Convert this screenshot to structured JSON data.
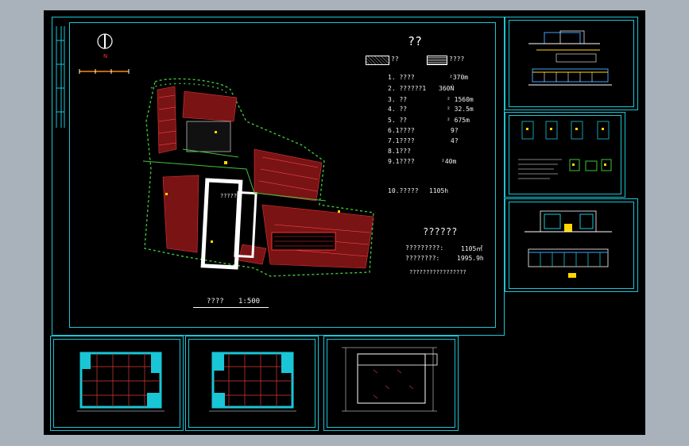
{
  "sheet_main": {
    "legend_title": "??",
    "legend_items": [
      "??",
      "????"
    ],
    "rows": [
      {
        "label": "1. ????",
        "value": "²370m"
      },
      {
        "label": "2. ??????1",
        "value": "360Ń"
      },
      {
        "label": "3. ??",
        "value": "² 1560m"
      },
      {
        "label": "4. ??",
        "value": "² 32.5m"
      },
      {
        "label": "5. ??",
        "value": "² 675m"
      },
      {
        "label": "6.1????",
        "value": "9?"
      },
      {
        "label": "7.1????",
        "value": "4?"
      },
      {
        "label": "8.1???",
        "value": ""
      },
      {
        "label": "9.1????",
        "value": "²40m"
      }
    ],
    "row10_label": "10.?????",
    "row10_value": "1105h",
    "summary_title": "??????",
    "summary_rows": [
      {
        "label": "?????????:",
        "value": "1105㎡"
      },
      {
        "label": "????????:",
        "value": "1995.9h"
      }
    ],
    "summary_note": "?????????????????",
    "building_label": "?????",
    "scale_label": "????",
    "scale_value": "1:500"
  },
  "colors": {
    "frame": "#19c6d6",
    "background": "#000000",
    "outer": "#a9b1bb",
    "roof_red": "#c0282a",
    "tree_green": "#3fc23b"
  }
}
